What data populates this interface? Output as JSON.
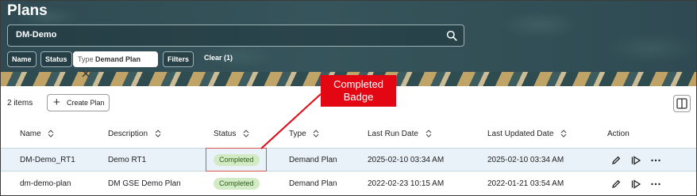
{
  "page": {
    "title": "Plans",
    "search": {
      "value": "DM-Demo"
    },
    "filters": {
      "name_chip": "Name",
      "status_chip": "Status",
      "type_chip_prefix": "Type",
      "type_chip_value": "Demand Plan",
      "filters_chip": "Filters",
      "clear_label": "Clear (1)"
    }
  },
  "callout": {
    "line1": "Completed",
    "line2": "Badge",
    "color": "#e30613"
  },
  "toolbar": {
    "items_count": "2 items",
    "create_label": "Create Plan"
  },
  "table": {
    "columns": [
      "Name",
      "Description",
      "Status",
      "Type",
      "Last Run Date",
      "Last Updated Date",
      "Action"
    ],
    "rows": [
      {
        "name": "DM-Demo_RT1",
        "description": "Demo RT1",
        "status": "Completed",
        "type": "Demand Plan",
        "last_run": "2025-02-10 03:34 AM",
        "last_updated": "2025-02-10 03:34 AM"
      },
      {
        "name": "dm-demo-plan",
        "description": "DM GSE Demo Plan",
        "status": "Completed",
        "type": "Demand Plan",
        "last_run": "2022-02-23 10:15 AM",
        "last_updated": "2022-01-21 03:54 AM"
      }
    ]
  },
  "icons": [
    "search-icon",
    "close-icon",
    "plus-icon",
    "panel-toggle-icon",
    "sort-icon",
    "edit-icon",
    "run-icon",
    "more-icon"
  ],
  "colors": {
    "header_bg": "#2f4a52",
    "selected_row": "#e9f2f8",
    "badge_bg": "#d3ebc4",
    "badge_text": "#2f5b1b"
  }
}
